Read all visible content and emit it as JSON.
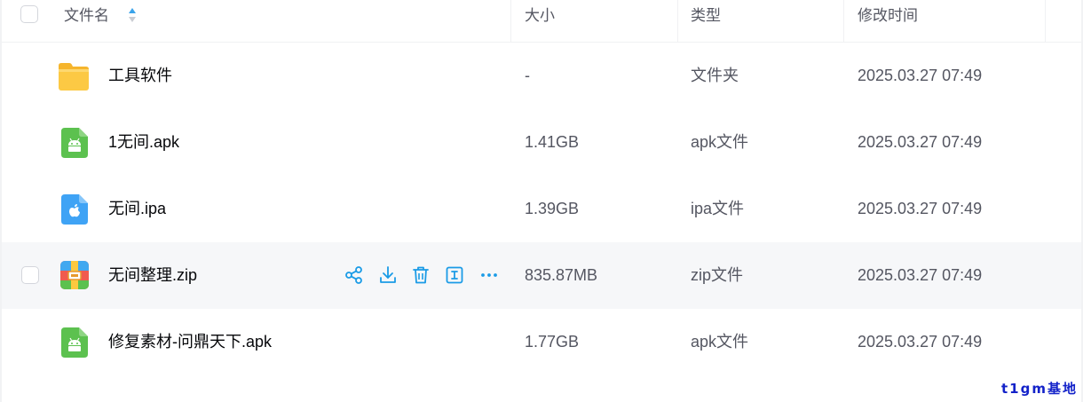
{
  "header": {
    "name": "文件名",
    "size": "大小",
    "type": "类型",
    "modified": "修改时间"
  },
  "rows": [
    {
      "icon": "folder-icon",
      "name": "工具软件",
      "size": "-",
      "type": "文件夹",
      "modified": "2025.03.27 07:49"
    },
    {
      "icon": "android-apk-icon",
      "name": "1无间.apk",
      "size": "1.41GB",
      "type": "apk文件",
      "modified": "2025.03.27 07:49"
    },
    {
      "icon": "apple-ipa-icon",
      "name": "无间.ipa",
      "size": "1.39GB",
      "type": "ipa文件",
      "modified": "2025.03.27 07:49"
    },
    {
      "icon": "zip-archive-icon",
      "name": "无间整理.zip",
      "size": "835.87MB",
      "type": "zip文件",
      "modified": "2025.03.27 07:49"
    },
    {
      "icon": "android-apk-icon",
      "name": "修复素材-问鼎天下.apk",
      "size": "1.77GB",
      "type": "apk文件",
      "modified": "2025.03.27 07:49"
    }
  ],
  "row_actions": [
    "share-icon",
    "download-icon",
    "delete-icon",
    "rename-icon",
    "more-icon"
  ],
  "watermark": "t1gm基地",
  "colors": {
    "accent": "#1a9be6",
    "hover_row": "#f6f7f9",
    "folder": "#fbc93f",
    "android": "#5cc14f",
    "apple": "#3fa3f5",
    "watermark": "#1322c9"
  }
}
